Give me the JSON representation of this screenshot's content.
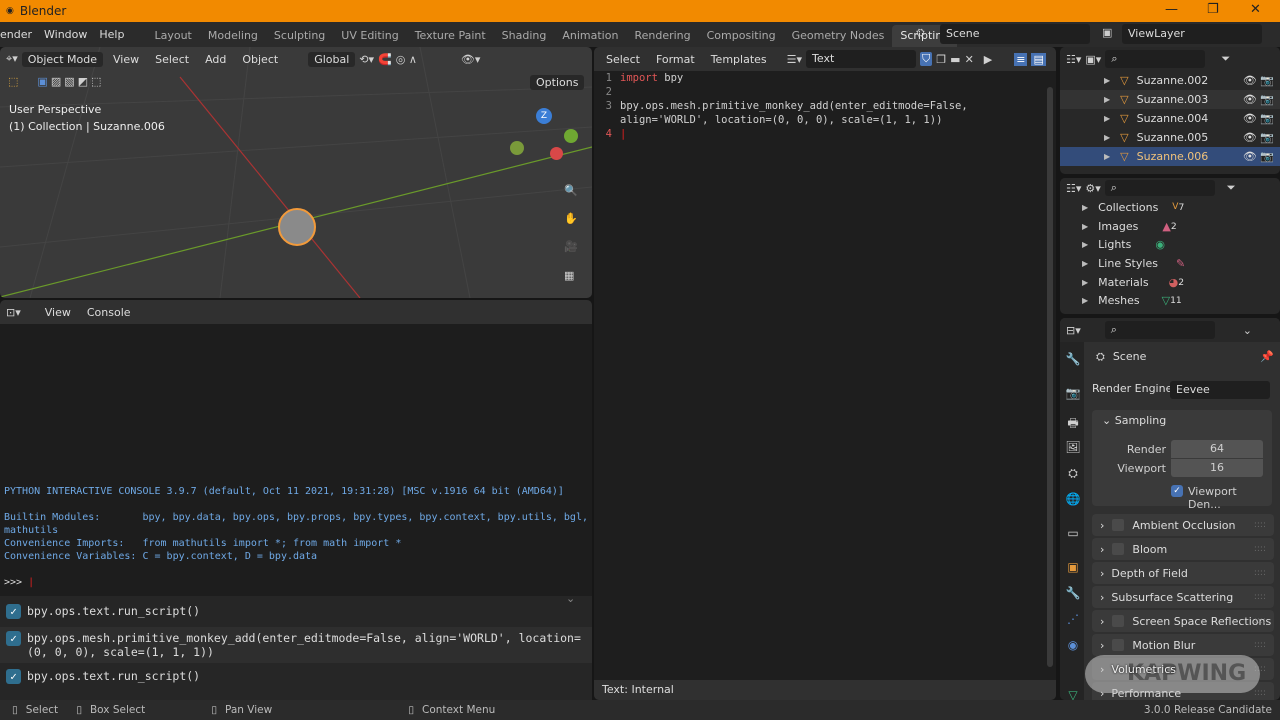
{
  "window": {
    "title": "Blender",
    "controls": [
      "—",
      "❐",
      "✕"
    ]
  },
  "menus": [
    "ender",
    "Window",
    "Help"
  ],
  "workspaces": [
    "Layout",
    "Modeling",
    "Sculpting",
    "UV Editing",
    "Texture Paint",
    "Shading",
    "Animation",
    "Rendering",
    "Compositing",
    "Geometry Nodes",
    "Scripting"
  ],
  "active_workspace": "Scripting",
  "scene": "Scene",
  "view_layer": "ViewLayer",
  "viewport": {
    "mode": "Object Mode",
    "menus": [
      "View",
      "Select",
      "Add",
      "Object"
    ],
    "orientation": "Global",
    "options": "Options",
    "view_name": "User Perspective",
    "collection_info": "(1) Collection | Suzanne.006",
    "gizmo": {
      "z": "Z"
    }
  },
  "console": {
    "menus": [
      "View",
      "Console"
    ],
    "banner": "PYTHON INTERACTIVE CONSOLE 3.9.7 (default, Oct 11 2021, 19:31:28) [MSC v.1916 64 bit (AMD64)]",
    "builtin": "Builtin Modules:       bpy, bpy.data, bpy.ops, bpy.props, bpy.types, bpy.context, bpy.utils, bgl, blf,\nmathutils",
    "imports": "Convenience Imports:   from mathutils import *; from math import *",
    "variables": "Convenience Variables: C = bpy.context, D = bpy.data",
    "prompt": ">>> "
  },
  "info_log": [
    "bpy.ops.text.run_script()",
    "bpy.ops.mesh.primitive_monkey_add(enter_editmode=False, align='WORLD', location=(0, 0, 0), scale=(1, 1, 1))",
    "bpy.ops.text.run_script()"
  ],
  "text_editor": {
    "menus": [
      "Select",
      "Format",
      "Templates"
    ],
    "text_name": "Text",
    "lines": {
      "l1_kw": "import",
      "l1_rest": " bpy",
      "l3a": "bpy.ops.mesh.primitive_monkey_add(enter_editmode=False,",
      "l3b": "align='WORLD', location=(0, 0, 0), scale=(1, 1, 1))"
    },
    "line_numbers": [
      "1",
      "2",
      "3",
      "4"
    ],
    "footer": "Text: Internal"
  },
  "outliner": {
    "items": [
      "Suzanne.002",
      "Suzanne.003",
      "Suzanne.004",
      "Suzanne.005",
      "Suzanne.006"
    ],
    "selected": "Suzanne.006"
  },
  "blend_file": {
    "items": [
      {
        "label": "Collections",
        "count": "7"
      },
      {
        "label": "Images",
        "count": "2"
      },
      {
        "label": "Lights",
        "count": ""
      },
      {
        "label": "Line Styles",
        "count": ""
      },
      {
        "label": "Materials",
        "count": "2"
      },
      {
        "label": "Meshes",
        "count": "11"
      }
    ]
  },
  "properties": {
    "context": "Scene",
    "render_engine_label": "Render Engine",
    "render_engine": "Eevee",
    "sampling": "Sampling",
    "render_label": "Render",
    "render_value": "64",
    "viewport_label": "Viewport",
    "viewport_value": "16",
    "denoise": "Viewport Den...",
    "panels": [
      "Ambient Occlusion",
      "Bloom",
      "Depth of Field",
      "Subsurface Scattering",
      "Screen Space Reflections",
      "Motion Blur",
      "Volumetrics",
      "Performance"
    ]
  },
  "status": {
    "select": "Select",
    "box_select": "Box Select",
    "pan": "Pan View",
    "context": "Context Menu",
    "version": "3.0.0 Release Candidate"
  },
  "watermark": "KAPWING",
  "colors": {
    "accent": "#f28a00",
    "selection": "#334c7a",
    "keyword": "#e05656"
  }
}
